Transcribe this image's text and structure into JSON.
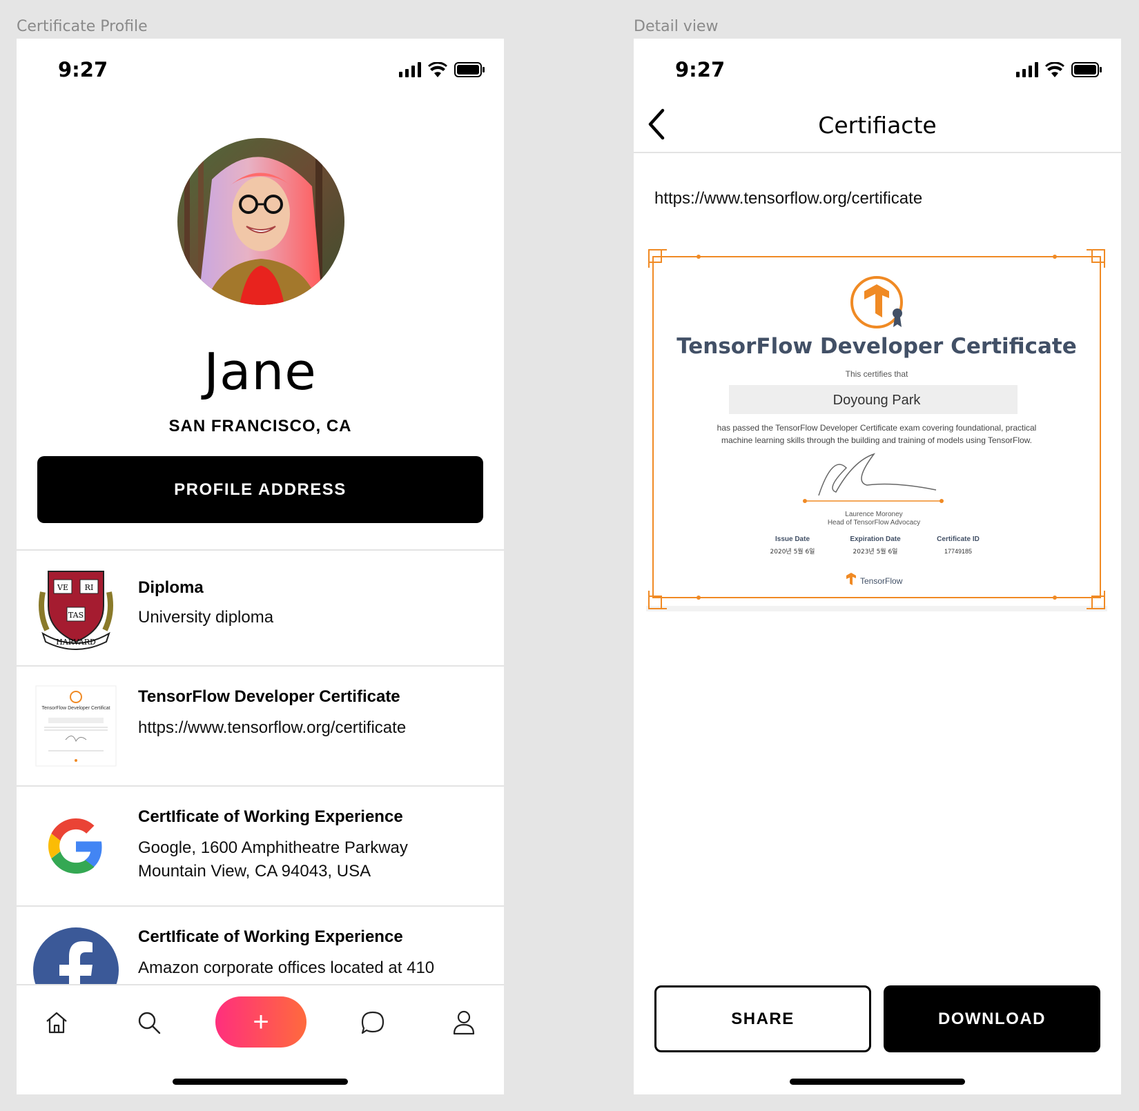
{
  "frames": {
    "left_label": "Certificate Profile",
    "right_label": "Detail view"
  },
  "status": {
    "time": "9:27"
  },
  "profile": {
    "name": "Jane",
    "location": "SAN FRANCISCO, CA",
    "address_button": "PROFILE ADDRESS"
  },
  "certificates": [
    {
      "title": "Diploma",
      "desc": "University diploma",
      "icon": "harvard-crest-icon",
      "crest_words": [
        "VE",
        "RI",
        "TAS",
        "HARVARD"
      ]
    },
    {
      "title": "TensorFlow Developer Certificate",
      "desc": "https://www.tensorflow.org/certificate",
      "icon": "certificate-thumbnail",
      "thumb_title": "TensorFlow Developer Certificat"
    },
    {
      "title": "CertIficate of Working Experience",
      "desc_line1": "Google, 1600 Amphitheatre Parkway",
      "desc_line2": "Mountain View, CA 94043, USA",
      "icon": "google-icon",
      "colors": {
        "blue": "#4285F4",
        "red": "#EA4335",
        "yellow": "#FBBC05",
        "green": "#34A853"
      }
    },
    {
      "title": "CertIficate of Working Experience",
      "desc": "Amazon corporate offices located at 410",
      "icon": "facebook-icon",
      "color": "#3b5998"
    }
  ],
  "tabbar": {
    "icons": [
      "home-icon",
      "search-icon",
      "add-icon",
      "chat-icon",
      "profile-icon"
    ],
    "fab_gradient": [
      "#ff2f7d",
      "#ff6a3d"
    ]
  },
  "detail": {
    "nav_title": "Certifiacte",
    "url": "https://www.tensorflow.org/certificate",
    "certificate": {
      "heading": "TensorFlow Developer Certificate",
      "certifies": "This certifies that",
      "recipient": "Doyoung Park",
      "body_line1": "has passed the TensorFlow Developer Certificate exam covering foundational, practical",
      "body_line2": "machine learning skills through the building and training of models using TensorFlow.",
      "signer_name": "Laurence Moroney",
      "signer_title": "Head of TensorFlow Advocacy",
      "issue_label": "Issue Date",
      "issue_value": "2020년 5월 6일",
      "expiry_label": "Expiration Date",
      "expiry_value": "2023년 5월 6일",
      "id_label": "Certificate ID",
      "id_value": "17749185",
      "brand": "TensorFlow",
      "accent": "#f08a24"
    },
    "share_button": "SHARE",
    "download_button": "DOWNLOAD"
  }
}
